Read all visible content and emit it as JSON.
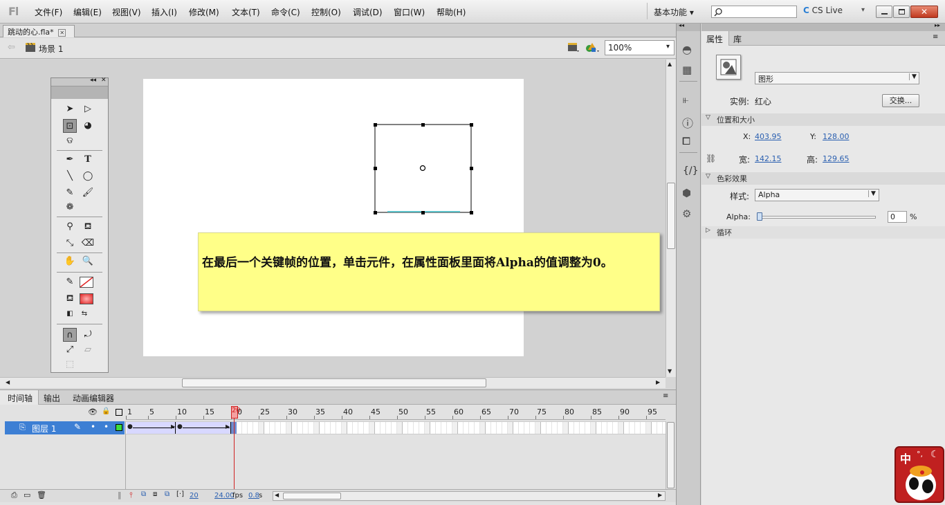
{
  "menubar": {
    "logo": "Fl",
    "items": [
      "文件(F)",
      "编辑(E)",
      "视图(V)",
      "插入(I)",
      "修改(M)",
      "文本(T)",
      "命令(C)",
      "控制(O)",
      "调试(D)",
      "窗口(W)",
      "帮助(H)"
    ],
    "workspace": "基本功能",
    "cslive": "CS Live"
  },
  "document": {
    "tab": "跳动的心.fla*",
    "scene": "场景 1",
    "zoom": "100%"
  },
  "note": {
    "text": "在最后一个关键帧的位置，单击元件，在属性面板里面将Alpha的值调整为0。"
  },
  "timeline": {
    "tabs": [
      "时间轴",
      "输出",
      "动画编辑器"
    ],
    "ruler": [
      "1",
      "5",
      "10",
      "15",
      "20",
      "25",
      "30",
      "35",
      "40",
      "45",
      "50",
      "55",
      "60",
      "65",
      "70",
      "75",
      "80",
      "85",
      "90",
      "95"
    ],
    "layer_name": "图层 1",
    "current_frame": "20",
    "fps": "24.00",
    "fps_unit": "fps",
    "time": "0.8",
    "time_unit": "s"
  },
  "properties": {
    "tabs": [
      "属性",
      "库"
    ],
    "symbol_type": "图形",
    "instance_label": "实例:",
    "instance_name": "红心",
    "swap_button": "交换...",
    "position_section": "位置和大小",
    "x_label": "X:",
    "x": "403.95",
    "y_label": "Y:",
    "y": "128.00",
    "w_label": "宽:",
    "w": "142.15",
    "h_label": "高:",
    "h": "129.65",
    "color_section": "色彩效果",
    "style_label": "样式:",
    "style_value": "Alpha",
    "alpha_label": "Alpha:",
    "alpha_value": "0",
    "alpha_unit": "%",
    "alpha_fraction": 0,
    "loop_section": "循环"
  },
  "ime": {
    "label": "中"
  }
}
